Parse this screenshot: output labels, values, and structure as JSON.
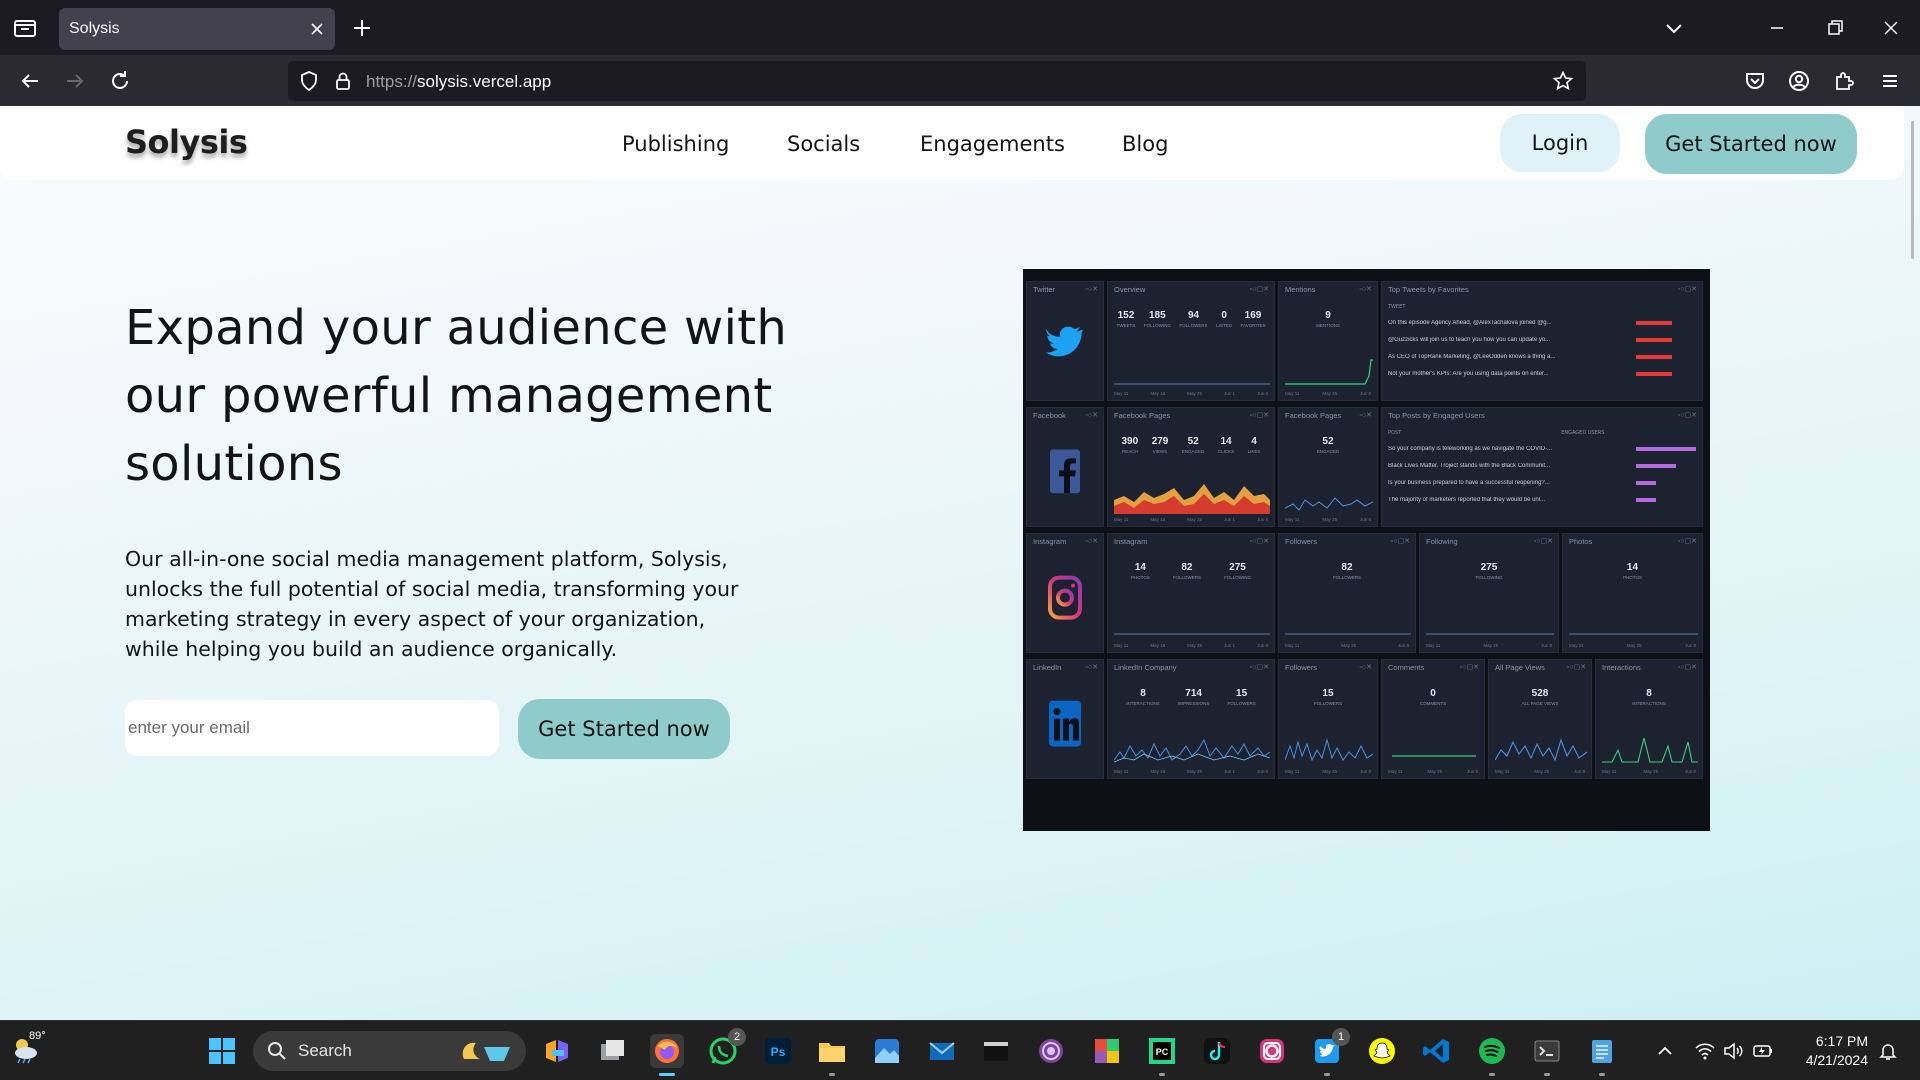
{
  "browser": {
    "tab_title": "Solysis",
    "url_protocol": "https://",
    "url_host": "solysis.vercel.app"
  },
  "site": {
    "logo": "Solysis",
    "nav": [
      "Publishing",
      "Socials",
      "Engagements",
      "Blog"
    ],
    "login_label": "Login",
    "header_cta_label": "Get Started now",
    "hero_title": "Expand your audience with our powerful management solutions",
    "hero_description": "Our all-in-one social media management platform, Solysis, unlocks the full potential of social media, transforming your marketing strategy in every aspect of your organization, while helping you build an audience organically.",
    "email_placeholder": "enter your email",
    "hero_cta_label": "Get Started now",
    "colors": {
      "cta": "#8ecbca",
      "login_bg": "#dff2f8",
      "text": "#141414"
    }
  },
  "dashboard": {
    "twitter": {
      "section": "Twitter",
      "overview": {
        "title": "Overview",
        "metrics": [
          {
            "value": "152",
            "label": "TWEETS"
          },
          {
            "value": "185",
            "label": "FOLLOWING"
          },
          {
            "value": "94",
            "label": "FOLLOWERS"
          },
          {
            "value": "0",
            "label": "LISTED"
          },
          {
            "value": "169",
            "label": "FAVORITES"
          }
        ]
      },
      "mentions": {
        "title": "Mentions",
        "value": "9",
        "label": "MENTIONS"
      },
      "top_tweets": {
        "title": "Top Tweets by Favorites",
        "column": "TWEET",
        "rows": [
          "On this episode Agency Ahead, @AlexTachalova joined @g...",
          "@Guzzicks will join us to teach you how you can update yo...",
          "As CEO of TopRank Marketing, @LeeOdden knows a thing a...",
          "Not your mother's KPIs: Are you using data points on enter..."
        ]
      }
    },
    "facebook": {
      "section": "Facebook",
      "pages": {
        "title": "Facebook Pages",
        "metrics": [
          {
            "value": "390",
            "label": "REACH"
          },
          {
            "value": "279",
            "label": "VIEWS"
          },
          {
            "value": "52",
            "label": "ENGAGED"
          },
          {
            "value": "14",
            "label": "CLICKS"
          },
          {
            "value": "4",
            "label": "LIKES"
          }
        ]
      },
      "pages2": {
        "title": "Facebook Pages",
        "value": "52",
        "label": "ENGAGED"
      },
      "top_posts": {
        "title": "Top Posts by Engaged Users",
        "col1": "POST",
        "col2": "ENGAGED USERS",
        "rows": [
          "So your company is teleworking as we navigate the COVID-...",
          "Black Lives Matter. Troject stands with the Black Communit...",
          "Is your business prepared to have a successful reopening?...",
          "The majority of marketers reported that they would be unl..."
        ]
      }
    },
    "instagram": {
      "section": "Instagram",
      "main": {
        "title": "Instagram",
        "metrics": [
          {
            "value": "14",
            "label": "PHOTOS"
          },
          {
            "value": "82",
            "label": "FOLLOWERS"
          },
          {
            "value": "275",
            "label": "FOLLOWING"
          }
        ]
      },
      "followers": {
        "title": "Followers",
        "value": "82",
        "label": "FOLLOWERS"
      },
      "following": {
        "title": "Following",
        "value": "275",
        "label": "FOLLOWING"
      },
      "photos": {
        "title": "Photos",
        "value": "14",
        "label": "PHOTOS"
      }
    },
    "linkedin": {
      "section": "LinkedIn",
      "company": {
        "title": "LinkedIn Company",
        "metrics": [
          {
            "value": "8",
            "label": "INTERACTIONS"
          },
          {
            "value": "714",
            "label": "IMPRESSIONS"
          },
          {
            "value": "15",
            "label": "FOLLOWERS"
          }
        ]
      },
      "followers": {
        "title": "Followers",
        "value": "15",
        "label": "FOLLOWERS"
      },
      "comments": {
        "title": "Comments",
        "value": "0",
        "label": "COMMENTS"
      },
      "page_views": {
        "title": "All Page Views",
        "value": "528",
        "label": "ALL PAGE VIEWS"
      },
      "interactions": {
        "title": "Interactions",
        "value": "8",
        "label": "INTERACTIONS"
      }
    },
    "axis_dates": [
      "May 11",
      "May 18",
      "May 25",
      "Jun 1",
      "Jun 8"
    ]
  },
  "taskbar": {
    "weather_temp": "89°",
    "search_label": "Search",
    "whatsapp_badge": "2",
    "twitter_badge": "1",
    "time": "6:17 PM",
    "date": "4/21/2024"
  }
}
